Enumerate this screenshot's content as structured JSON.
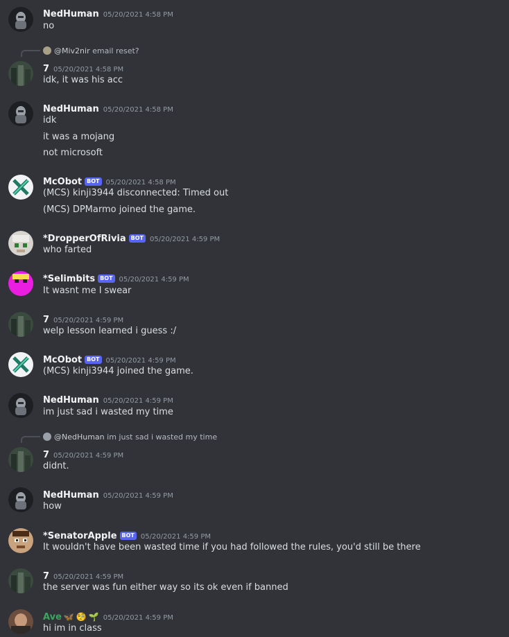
{
  "messages": [
    {
      "author": "NedHuman",
      "time": "05/20/2021 4:58 PM",
      "lines": [
        "no"
      ]
    },
    {
      "reply": {
        "name": "@Miv2nir",
        "text": "email reset?"
      },
      "author": "7",
      "time": "05/20/2021 4:58 PM",
      "lines": [
        "idk, it was his acc"
      ]
    },
    {
      "author": "NedHuman",
      "time": "05/20/2021 4:58 PM",
      "lines": [
        "idk",
        "it was a mojang",
        "not microsoft"
      ]
    },
    {
      "author": "McObot",
      "bot": "BOT",
      "time": "05/20/2021 4:58 PM",
      "lines": [
        "(MCS) kinji3944 disconnected: Timed out",
        "(MCS) DPMarmo joined the game."
      ]
    },
    {
      "author": "*DropperOfRivia",
      "bot": "BOT",
      "time": "05/20/2021 4:59 PM",
      "lines": [
        "who farted"
      ]
    },
    {
      "author": "*Selimbits",
      "bot": "BOT",
      "time": "05/20/2021 4:59 PM",
      "lines": [
        "It wasnt me I swear"
      ]
    },
    {
      "author": "7",
      "time": "05/20/2021 4:59 PM",
      "lines": [
        "welp lesson learned i guess :/"
      ]
    },
    {
      "author": "McObot",
      "bot": "BOT",
      "time": "05/20/2021 4:59 PM",
      "lines": [
        "(MCS) kinji3944 joined the game."
      ]
    },
    {
      "author": "NedHuman",
      "time": "05/20/2021 4:59 PM",
      "lines": [
        "im just sad i wasted my time"
      ]
    },
    {
      "reply": {
        "name": "@NedHuman",
        "text": "im just sad i wasted my time"
      },
      "author": "7",
      "time": "05/20/2021 4:59 PM",
      "lines": [
        "didnt."
      ]
    },
    {
      "author": "NedHuman",
      "time": "05/20/2021 4:59 PM",
      "lines": [
        "how"
      ]
    },
    {
      "author": "*SenatorApple",
      "bot": "BOT",
      "time": "05/20/2021 4:59 PM",
      "lines": [
        "It wouldn't have been wasted time if you had followed the rules, you'd still be there"
      ]
    },
    {
      "author": "7",
      "time": "05/20/2021 4:59 PM",
      "lines": [
        "the server was fun either way so its ok even if banned"
      ]
    },
    {
      "author": "Ave",
      "time": "05/20/2021 4:59 PM",
      "lines": [
        "hi im in class"
      ]
    }
  ]
}
